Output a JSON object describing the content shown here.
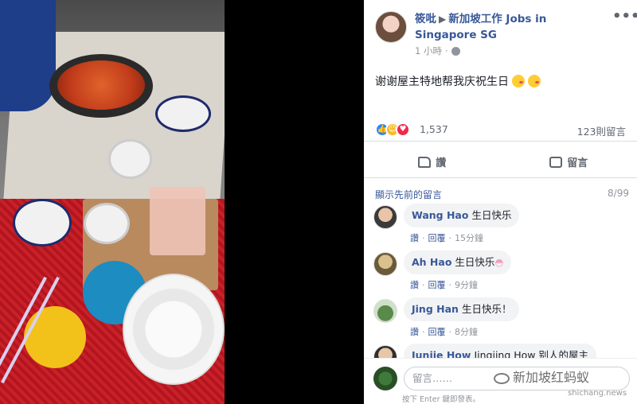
{
  "post": {
    "author": "筱吡",
    "group": "新加坡工作 Jobs in Singapore SG",
    "time": "1 小時",
    "more": "•••",
    "text": "谢谢屋主特地帮我庆祝生日",
    "reactions": {
      "count": "1,537",
      "icons": [
        "like-icon",
        "haha-icon",
        "love-icon"
      ]
    },
    "comment_count": "123則留言",
    "actions": {
      "like": "讚",
      "comment": "留言"
    }
  },
  "comments_section": {
    "previous_label": "顯示先前的留言",
    "pages": "8/99",
    "items": [
      {
        "name": "Wang Hao",
        "text": "生日快乐",
        "like": "讚",
        "reply": "回覆",
        "time": "15分鐘"
      },
      {
        "name": "Ah Hao",
        "text": "生日快乐",
        "like": "讚",
        "reply": "回覆",
        "time": "9分鐘"
      },
      {
        "name": "Jing Han",
        "text": "生日快乐！",
        "like": "讚",
        "reply": "回覆",
        "time": "8分鐘"
      },
      {
        "name": "Junjie How",
        "text": "Jingjing How 别人的屋主",
        "like": "",
        "reply": "",
        "time": ""
      }
    ]
  },
  "comment_box": {
    "placeholder": "留言……",
    "hint": "按下 Enter 鍵即發表。"
  },
  "watermark": {
    "title": "新加坡红蚂蚁",
    "url": "shichang.news"
  }
}
